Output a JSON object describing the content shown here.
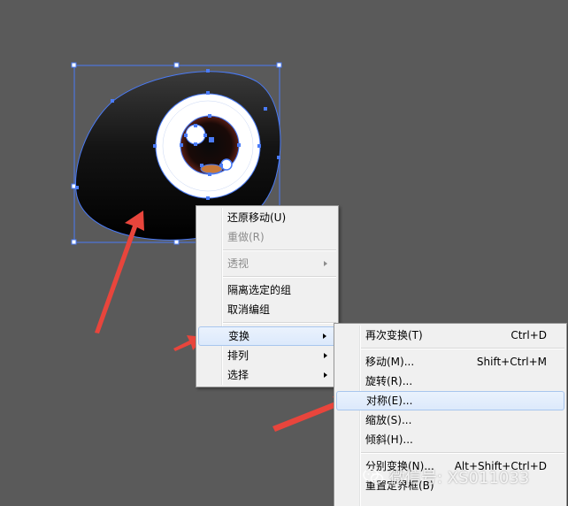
{
  "context_menu": {
    "items": [
      {
        "label": "还原移动(U)",
        "enabled": true,
        "submenu": false
      },
      {
        "label": "重做(R)",
        "enabled": false,
        "submenu": false
      },
      {
        "separator": true
      },
      {
        "label": "透视",
        "enabled": false,
        "submenu": true
      },
      {
        "separator": true
      },
      {
        "label": "隔离选定的组",
        "enabled": true,
        "submenu": false
      },
      {
        "label": "取消编组",
        "enabled": true,
        "submenu": false
      },
      {
        "separator": true
      },
      {
        "label": "变换",
        "enabled": true,
        "submenu": true,
        "highlighted": true
      },
      {
        "label": "排列",
        "enabled": true,
        "submenu": true
      },
      {
        "label": "选择",
        "enabled": true,
        "submenu": true
      }
    ]
  },
  "transform_submenu": {
    "items": [
      {
        "label": "再次变换(T)",
        "shortcut": "Ctrl+D"
      },
      {
        "separator": true
      },
      {
        "label": "移动(M)...",
        "shortcut": "Shift+Ctrl+M"
      },
      {
        "label": "旋转(R)..."
      },
      {
        "label": "对称(E)...",
        "highlighted": true
      },
      {
        "label": "缩放(S)..."
      },
      {
        "label": "倾斜(H)..."
      },
      {
        "separator": true
      },
      {
        "label": "分别变换(N)...",
        "shortcut": "Alt+Shift+Ctrl+D"
      },
      {
        "label": "重置定界框(B)"
      }
    ]
  },
  "watermark": {
    "text": "微信号: XS011033",
    "icon": "wechat-icon"
  },
  "colors": {
    "canvas_background": "#5a5a5a",
    "selection_blue": "#4a7bf7",
    "annotation_arrow": "#e8453c",
    "menu_background": "#f0f0f0",
    "menu_highlight": "#dce9fb"
  }
}
